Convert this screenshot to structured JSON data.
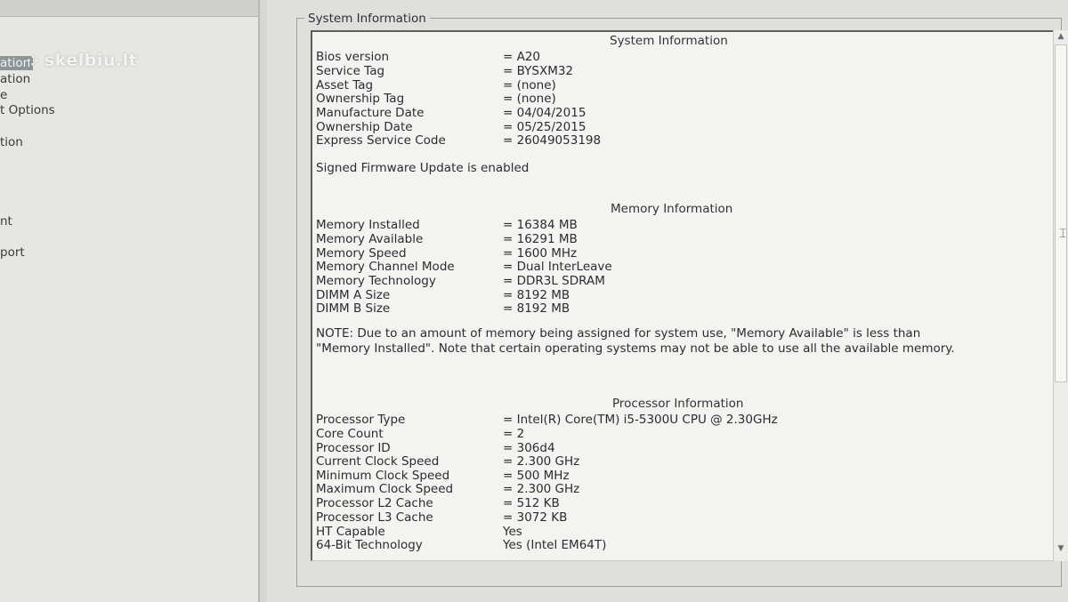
{
  "watermark": "skelbiu.lt",
  "sidebar": {
    "items": [
      {
        "label": "ation",
        "selected": true
      },
      {
        "label": "ation"
      },
      {
        "label": "e"
      },
      {
        "label": "t Options"
      },
      {
        "label": "tion"
      },
      {
        "label": "nt"
      },
      {
        "label": "port"
      }
    ]
  },
  "main": {
    "group_title": "System Information",
    "system": {
      "heading": "System Information",
      "rows": [
        {
          "label": "Bios version",
          "value": "= A20"
        },
        {
          "label": "Service Tag",
          "value": "= BYSXM32"
        },
        {
          "label": "Asset Tag",
          "value": "= (none)"
        },
        {
          "label": "Ownership Tag",
          "value": "= (none)"
        },
        {
          "label": "Manufacture Date",
          "value": "= 04/04/2015"
        },
        {
          "label": "Ownership Date",
          "value": "= 05/25/2015"
        },
        {
          "label": "Express Service Code",
          "value": "= 26049053198"
        }
      ],
      "firmware_note": "Signed Firmware Update is enabled"
    },
    "memory": {
      "heading": "Memory Information",
      "rows": [
        {
          "label": "Memory Installed",
          "value": "= 16384 MB"
        },
        {
          "label": "Memory Available",
          "value": "= 16291 MB"
        },
        {
          "label": "Memory Speed",
          "value": "= 1600 MHz"
        },
        {
          "label": "Memory Channel Mode",
          "value": "= Dual InterLeave"
        },
        {
          "label": "Memory Technology",
          "value": "= DDR3L SDRAM"
        },
        {
          "label": "DIMM A Size",
          "value": "= 8192 MB"
        },
        {
          "label": "DIMM B Size",
          "value": "= 8192 MB"
        }
      ],
      "note": "NOTE: Due to an amount of memory being assigned for system use, \"Memory Available\" is less than \"Memory Installed\". Note that certain operating systems may not be able to use all the available memory."
    },
    "processor": {
      "heading": "Processor Information",
      "rows": [
        {
          "label": "Processor Type",
          "value": "= Intel(R) Core(TM) i5-5300U CPU @ 2.30GHz"
        },
        {
          "label": "Core Count",
          "value": "= 2"
        },
        {
          "label": "Processor ID",
          "value": "= 306d4"
        },
        {
          "label": "Current Clock Speed",
          "value": "= 2.300 GHz"
        },
        {
          "label": "Minimum Clock Speed",
          "value": "= 500 MHz"
        },
        {
          "label": "Maximum Clock Speed",
          "value": "= 2.300 GHz"
        },
        {
          "label": "Processor L2 Cache",
          "value": "= 512 KB"
        },
        {
          "label": "Processor L3 Cache",
          "value": "= 3072 KB"
        },
        {
          "label": "HT Capable",
          "value": "Yes"
        },
        {
          "label": "64-Bit Technology",
          "value": "Yes (Intel EM64T)"
        }
      ]
    }
  }
}
